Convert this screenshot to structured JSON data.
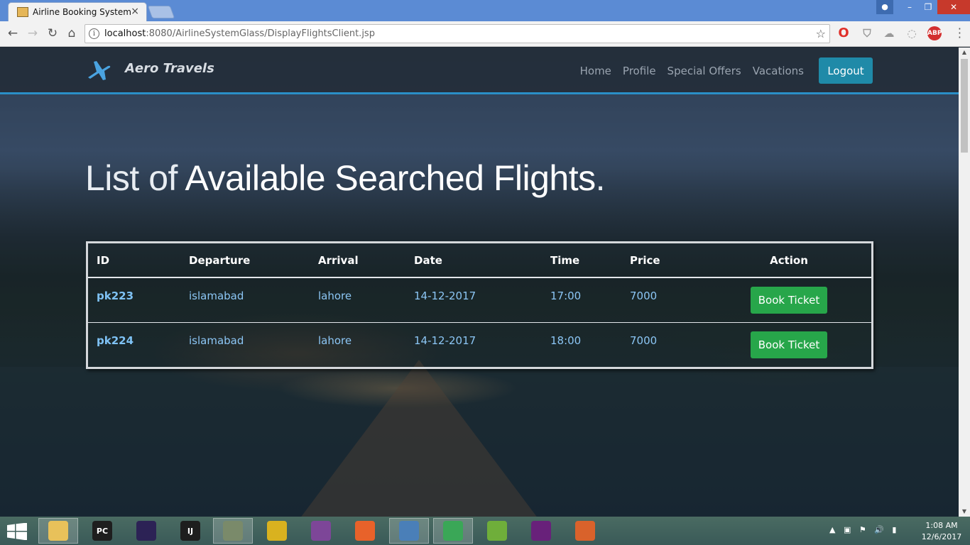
{
  "browser": {
    "tab_title": "Airline Booking System",
    "url_host": "localhost",
    "url_rest": ":8080/AirlineSystemGlass/DisplayFlightsClient.jsp",
    "extensions": [
      {
        "icon": "opera-icon",
        "color": "#e0302a"
      },
      {
        "icon": "shield-badge-icon",
        "color": "#9a9a9a",
        "badge": "1"
      },
      {
        "icon": "cloud-icon",
        "color": "#9a9a9a"
      },
      {
        "icon": "circle-icon",
        "color": "#9a9a9a"
      },
      {
        "icon": "abp-icon",
        "color": "#d32f2f",
        "label": "ABP"
      }
    ]
  },
  "site": {
    "brand": "Aero Travels",
    "nav": [
      "Home",
      "Profile",
      "Special Offers",
      "Vacations"
    ],
    "logout": "Logout"
  },
  "heading": {
    "light": "List of ",
    "bold": "Available Searched Flights",
    "dot": "."
  },
  "table": {
    "headers": [
      "ID",
      "Departure",
      "Arrival",
      "Date",
      "Time",
      "Price",
      "Action"
    ],
    "rows": [
      {
        "id": "pk223",
        "departure": "islamabad",
        "arrival": "lahore",
        "date": "14-12-2017",
        "time": "17:00",
        "price": "7000",
        "action": "Book Ticket"
      },
      {
        "id": "pk224",
        "departure": "islamabad",
        "arrival": "lahore",
        "date": "14-12-2017",
        "time": "18:00",
        "price": "7000",
        "action": "Book Ticket"
      }
    ]
  },
  "taskbar": {
    "apps": [
      {
        "icon": "file-explorer-icon",
        "label": "",
        "color": "#e8c15a"
      },
      {
        "icon": "pycharm-icon",
        "label": "PC",
        "color": "#1e1e1e"
      },
      {
        "icon": "eclipse-icon",
        "label": "",
        "color": "#2c2255"
      },
      {
        "icon": "intellij-icon",
        "label": "IJ",
        "color": "#1e1e1e"
      },
      {
        "icon": "tools-icon",
        "label": "",
        "color": "#7a8a6a"
      },
      {
        "icon": "puzzle-icon",
        "label": "",
        "color": "#d9b21f"
      },
      {
        "icon": "tor-icon",
        "label": "",
        "color": "#7d4698"
      },
      {
        "icon": "firefox-icon",
        "label": "",
        "color": "#e8622a"
      },
      {
        "icon": "virtualbox-icon",
        "label": "",
        "color": "#4a7fb8"
      },
      {
        "icon": "chrome-icon",
        "label": "",
        "color": "#3aa757"
      },
      {
        "icon": "notepad-plus-icon",
        "label": "",
        "color": "#6fae3a"
      },
      {
        "icon": "visual-studio-icon",
        "label": "",
        "color": "#68217a"
      },
      {
        "icon": "matlab-icon",
        "label": "",
        "color": "#d9622b"
      }
    ],
    "clock_time": "1:08 AM",
    "clock_date": "12/6/2017"
  }
}
